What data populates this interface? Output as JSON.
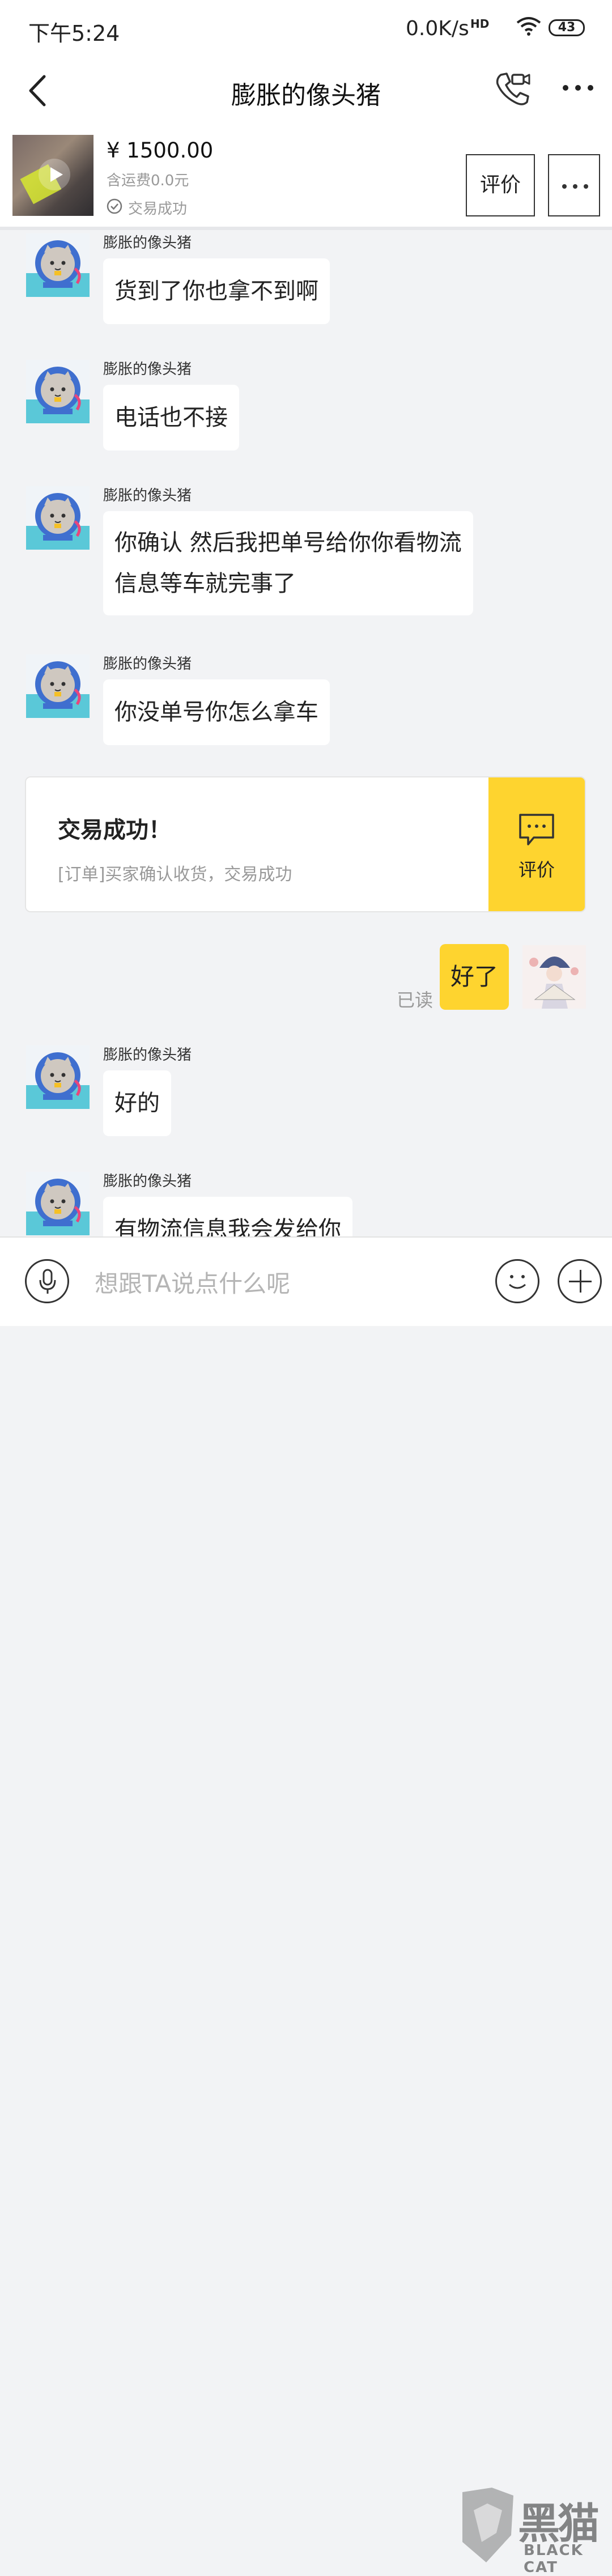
{
  "status_bar": {
    "time": "下午5:24",
    "net_speed": "0.0K/s",
    "hd": "HD",
    "battery": "43"
  },
  "header": {
    "title": "膨胀的像头猪"
  },
  "product": {
    "price": "¥ 1500.00",
    "shipping": "含运费0.0元",
    "status": "交易成功",
    "review_button": "评价"
  },
  "messages": [
    {
      "sender": "膨胀的像头猪",
      "text": "货到了你也拿不到啊"
    },
    {
      "sender": "膨胀的像头猪",
      "text": "电话也不接"
    },
    {
      "sender": "膨胀的像头猪",
      "lines": [
        "你确认 然后我把单号给你你看物流",
        "信息等车就完事了"
      ]
    },
    {
      "sender": "膨胀的像头猪",
      "text": "你没单号你怎么拿车"
    },
    {
      "sender": "膨胀的像头猪",
      "text": "好的"
    },
    {
      "sender": "膨胀的像头猪",
      "text": "有物流信息我会发给你"
    }
  ],
  "system_card": {
    "title": "交易成功！",
    "description": "[订单]买家确认收货，交易成功",
    "action_label": "评价"
  },
  "my_message": {
    "text": "好了",
    "read_status": "已读"
  },
  "input": {
    "placeholder": "想跟TA说点什么呢"
  },
  "watermark": {
    "cn": "黑猫",
    "en": "BLACK CAT"
  },
  "colors": {
    "accent": "#fed42f",
    "background": "#f2f3f5"
  }
}
